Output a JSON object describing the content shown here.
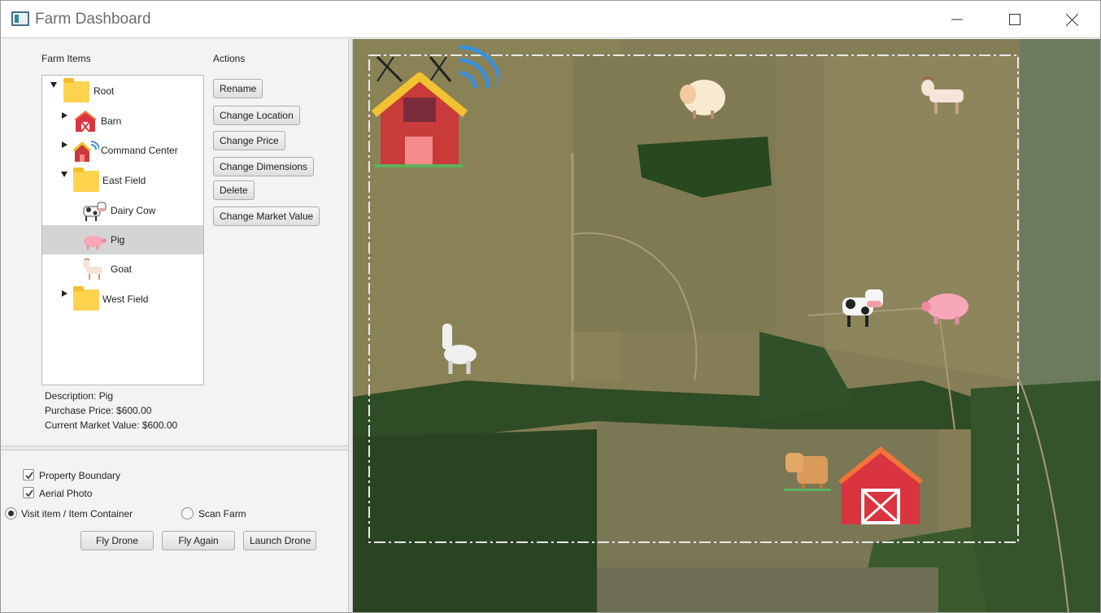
{
  "window": {
    "title": "Farm Dashboard"
  },
  "left": {
    "farm_items_label": "Farm Items",
    "actions_label": "Actions",
    "tree": [
      {
        "label": "Root",
        "icon": "folder-icon",
        "expanded": true,
        "level": 0
      },
      {
        "label": "Barn",
        "icon": "barn-icon",
        "expanded": false,
        "level": 1
      },
      {
        "label": "Command Center",
        "icon": "command-center-icon",
        "expanded": false,
        "level": 1
      },
      {
        "label": "East Field",
        "icon": "folder-icon",
        "expanded": true,
        "level": 1
      },
      {
        "label": "Dairy Cow",
        "icon": "cow-icon",
        "level": 2
      },
      {
        "label": "Pig",
        "icon": "pig-icon",
        "level": 2,
        "selected": true
      },
      {
        "label": "Goat",
        "icon": "goat-icon",
        "level": 2
      },
      {
        "label": "West Field",
        "icon": "folder-icon",
        "expanded": false,
        "level": 1
      }
    ],
    "actions": [
      "Rename",
      "Change Location",
      "Change Price",
      "Change Dimensions",
      "Delete",
      "Change Market Value"
    ],
    "info": {
      "description": "Description: Pig",
      "purchase_price": "Purchase Price: $600.00",
      "market_value": "Current Market Value: $600.00"
    }
  },
  "controls": {
    "property_boundary": {
      "label": "Property Boundary",
      "checked": true
    },
    "aerial_photo": {
      "label": "Aerial Photo",
      "checked": true
    },
    "visit_item": {
      "label": "Visit item / Item Container",
      "selected": true
    },
    "scan_farm": {
      "label": "Scan Farm",
      "selected": false
    },
    "fly_drone": "Fly Drone",
    "fly_again": "Fly Again",
    "launch_drone": "Launch Drone"
  },
  "map": {
    "markers": [
      "command-center-icon",
      "sheep-icon",
      "goat-icon",
      "llama-icon",
      "cow-icon",
      "pig-icon",
      "ox-icon",
      "barn-icon"
    ],
    "boundary_color": "#e8e8e8"
  }
}
